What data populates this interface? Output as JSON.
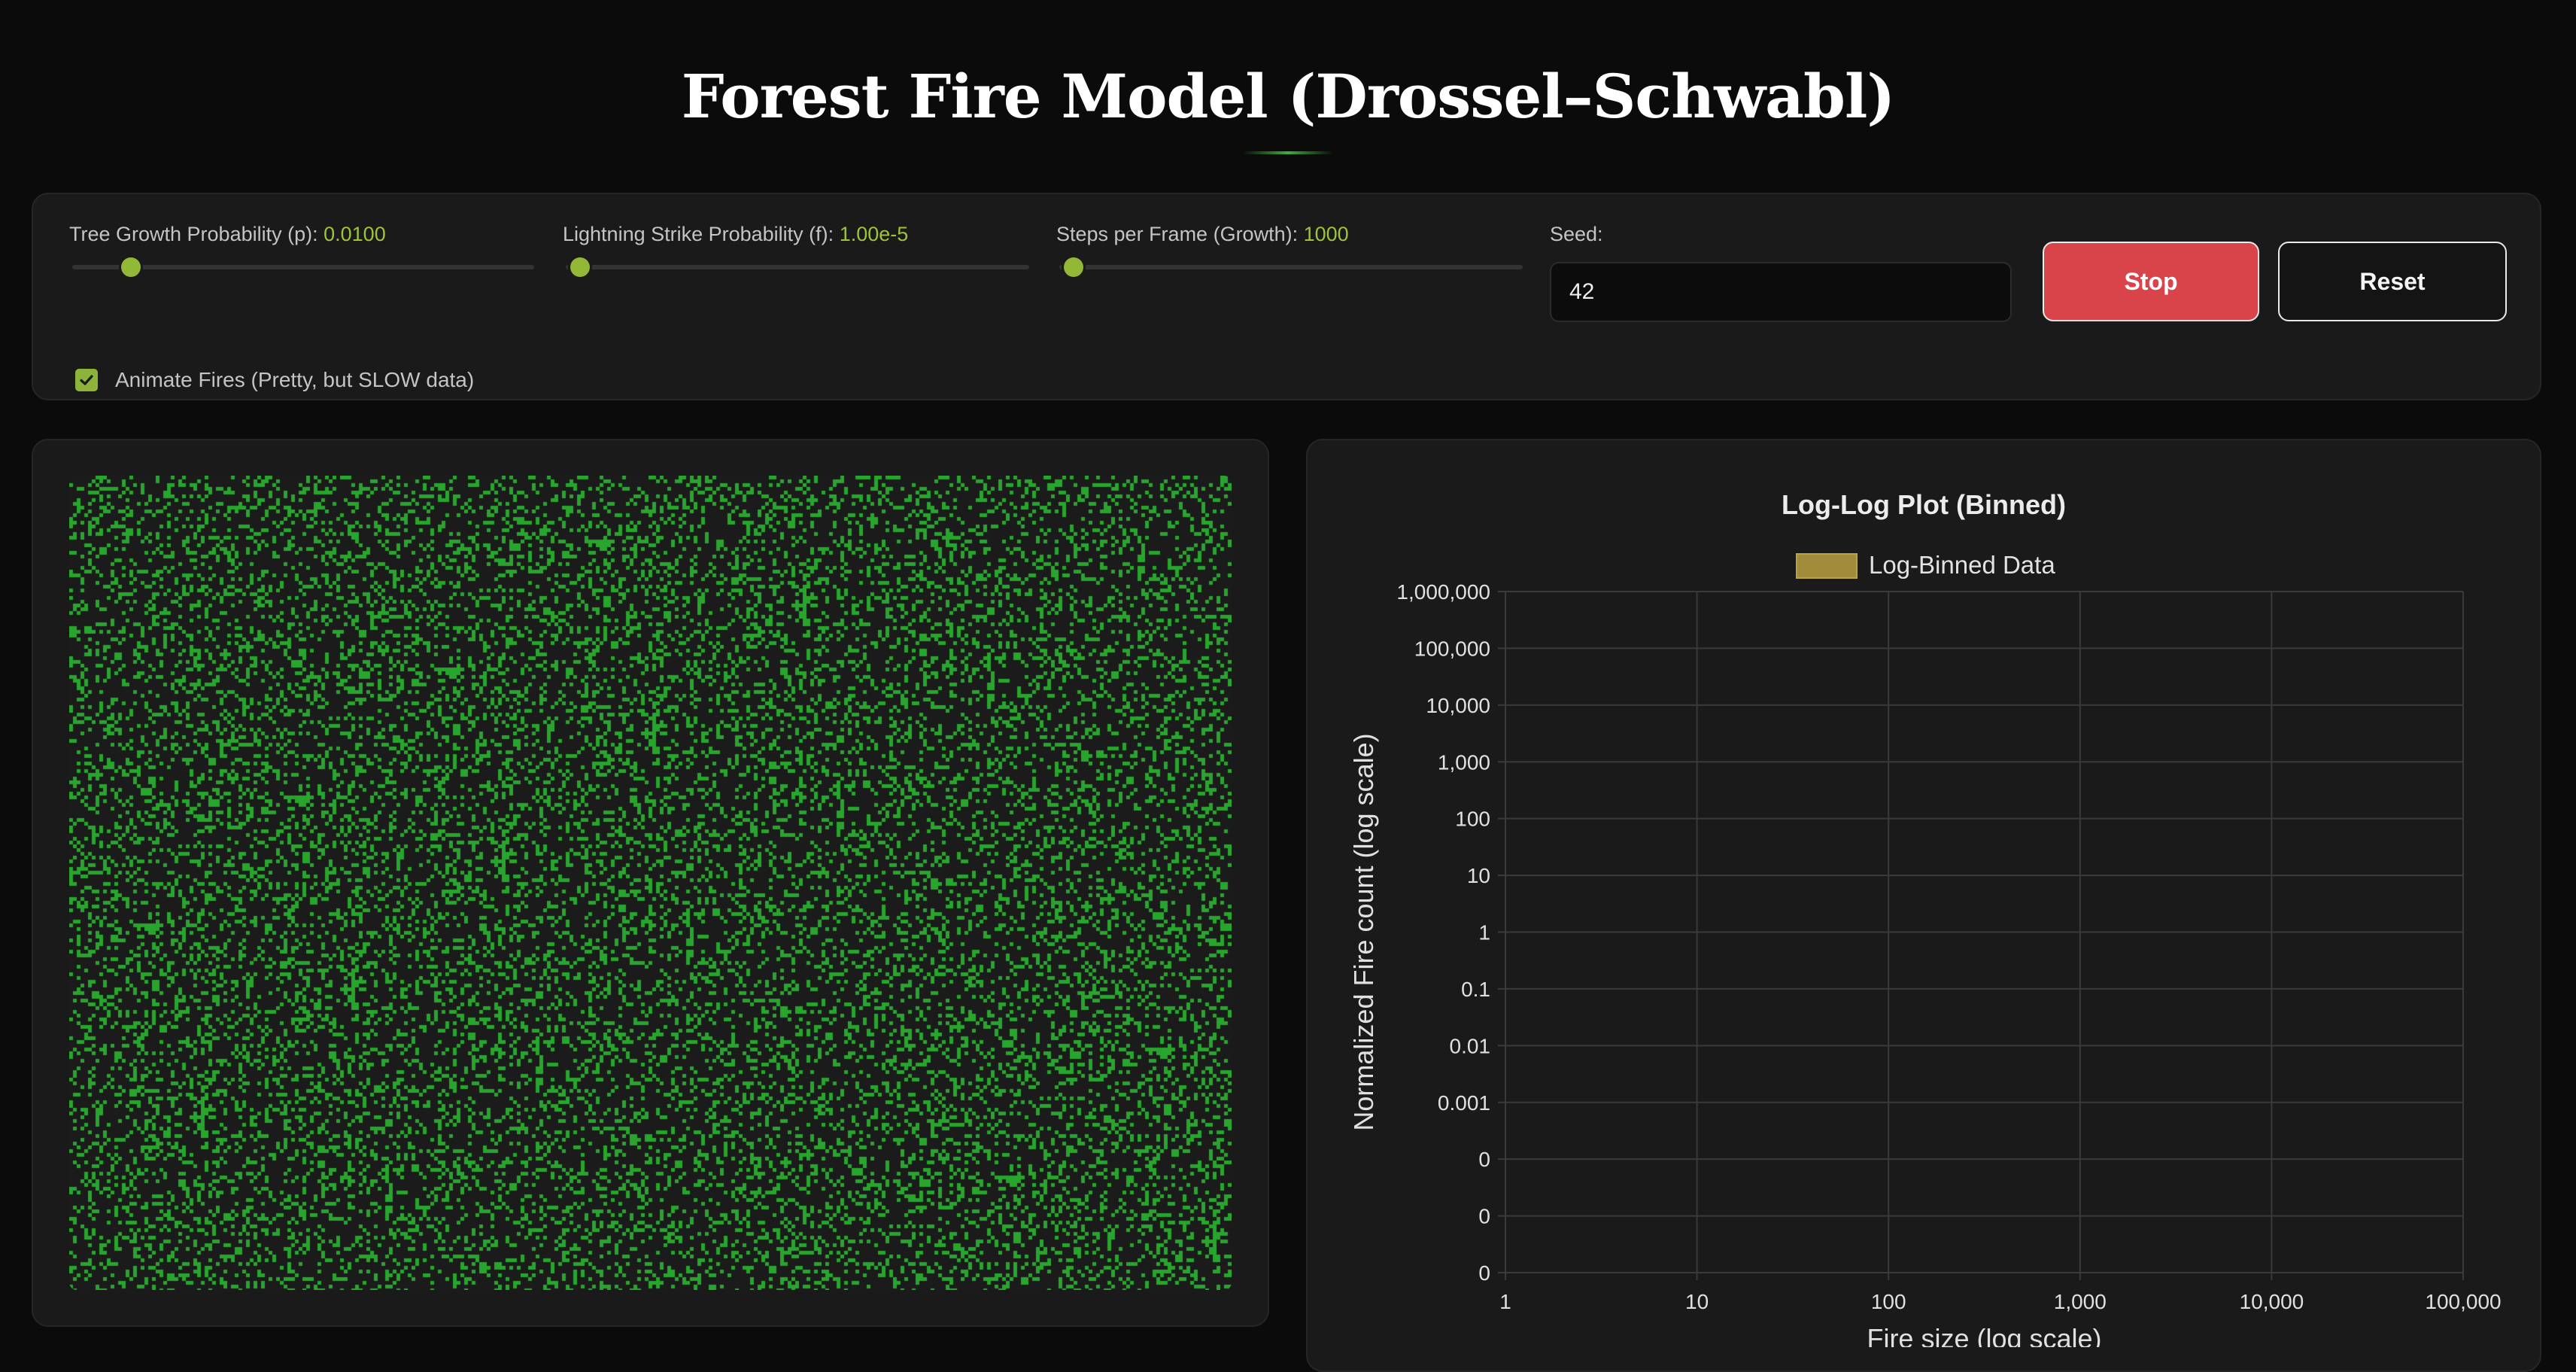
{
  "page_title": "Forest Fire Model (Drossel–Schwabl)",
  "controls": {
    "growth": {
      "label": "Tree Growth Probability (p):",
      "value": "0.0100",
      "fraction": 0.11
    },
    "lightning": {
      "label": "Lightning Strike Probability (f):",
      "value": "1.00e-5",
      "fraction": 0.01
    },
    "steps": {
      "label": "Steps per Frame (Growth):",
      "value": "1000",
      "fraction": 0.01
    },
    "seed": {
      "label": "Seed:",
      "value": "42"
    },
    "stop_label": "Stop",
    "reset_label": "Reset",
    "animate": {
      "label": "Animate Fires (Pretty, but SLOW data)",
      "checked": true
    }
  },
  "simulation": {
    "tree_color": "#27a52d",
    "empty_color": "#1b1b1b",
    "tree_density": 0.24
  },
  "colors": {
    "accent": "#9dc43a",
    "stop": "#d9444a",
    "legend": "#a08c3a"
  },
  "chart_data": {
    "type": "scatter",
    "title": "Log-Log Plot (Binned)",
    "legend": [
      "Log-Binned Data"
    ],
    "legend_position": "top",
    "xlabel": "Fire size (log scale)",
    "ylabel": "Normalized Fire count (log scale)",
    "x_scale": "log",
    "y_scale": "log",
    "xlim": [
      1,
      100000
    ],
    "x_ticks": [
      "1",
      "10",
      "100",
      "1,000",
      "10,000",
      "100,000"
    ],
    "y_ticks": [
      "1,000,000",
      "100,000",
      "10,000",
      "1,000",
      "100",
      "10",
      "1",
      "0.1",
      "0.01",
      "0.001",
      "0",
      "0",
      "0"
    ],
    "grid": true,
    "series": [
      {
        "name": "Log-Binned Data",
        "values": []
      }
    ]
  }
}
